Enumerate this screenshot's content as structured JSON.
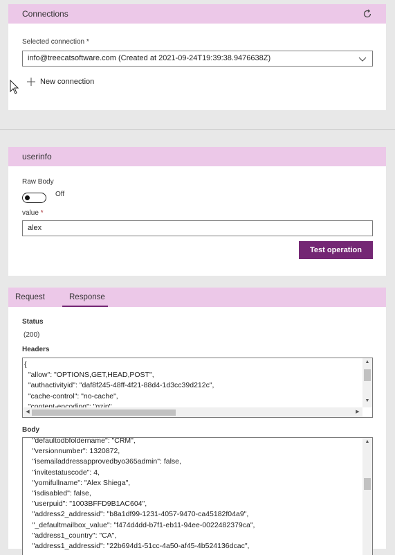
{
  "connections": {
    "title": "Connections",
    "refresh_icon": "refresh-icon",
    "selected_label": "Selected connection *",
    "selected_value": "info@treecatsoftware.com (Created at 2021-09-24T19:39:38.9476638Z)",
    "new_connection_label": "New connection"
  },
  "userinfo": {
    "title": "userinfo",
    "raw_body_label": "Raw Body",
    "toggle_state": "Off",
    "value_label": "value",
    "value_required": "*",
    "value": "alex",
    "test_button": "Test operation"
  },
  "response_panel": {
    "tabs": [
      "Request",
      "Response"
    ],
    "active_tab": "Response",
    "status_label": "Status",
    "status_value": "(200)",
    "headers_label": "Headers",
    "headers_lines": [
      "{",
      "  \"allow\": \"OPTIONS,GET,HEAD,POST\",",
      "  \"authactivityid\": \"daf8f245-48ff-4f21-88d4-1d3cc39d212c\",",
      "  \"cache-control\": \"no-cache\",",
      "  \"content-encoding\": \"gzip\","
    ],
    "body_label": "Body",
    "body_lines": [
      "    \"defaultodbfoldername\": \"CRM\",",
      "    \"versionnumber\": 1320872,",
      "    \"isemailaddressapprovedbyo365admin\": false,",
      "    \"invitestatuscode\": 4,",
      "    \"yomifullname\": \"Alex Shiega\",",
      "    \"isdisabled\": false,",
      "    \"userpuid\": \"1003BFFD9B1AC604\",",
      "    \"address2_addressid\": \"b8a1df99-1231-4057-9470-ca45182f04a9\",",
      "    \"_defaultmailbox_value\": \"f474d4dd-b7f1-eb11-94ee-0022482379ca\",",
      "    \"address1_country\": \"CA\",",
      "    \"address1_addressid\": \"22b694d1-51cc-4a50-af45-4b524136dcac\","
    ]
  },
  "colors": {
    "header_bg": "#ecc8e8",
    "accent": "#742774",
    "page_bg": "#e8e8e8"
  }
}
